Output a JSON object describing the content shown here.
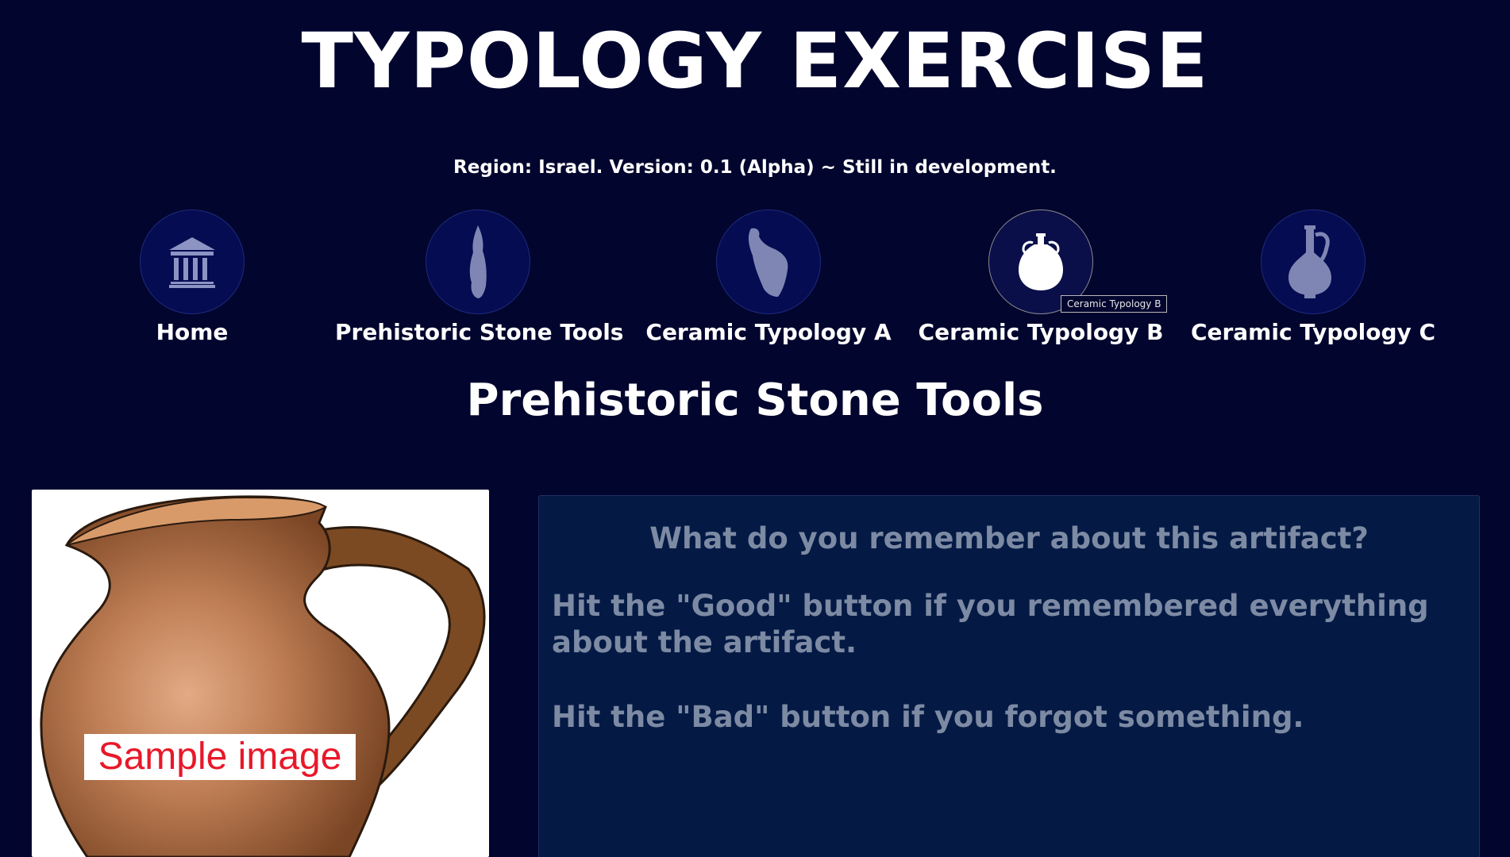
{
  "header": {
    "title": "TYPOLOGY EXERCISE",
    "subtitle": "Region: Israel. Version: 0.1 (Alpha) ~ Still in development."
  },
  "nav": {
    "items": [
      {
        "label": "Home",
        "icon": "building-icon"
      },
      {
        "label": "Prehistoric Stone Tools",
        "icon": "stone-tool-icon"
      },
      {
        "label": "Ceramic Typology A",
        "icon": "pottery-shard-icon"
      },
      {
        "label": "Ceramic Typology B",
        "icon": "amphora-icon",
        "active": true
      },
      {
        "label": "Ceramic Typology C",
        "icon": "jug-icon"
      }
    ],
    "tooltip": "Ceramic Typology B"
  },
  "section": {
    "title": "Prehistoric Stone Tools"
  },
  "artifact": {
    "image_label": "Sample image"
  },
  "prompt": {
    "question": "What do you remember about this artifact?",
    "good_instruction": "Hit the \"Good\" button if you remembered everything about the artifact.",
    "bad_instruction": "Hit the \"Bad\" button if you forgot something."
  },
  "colors": {
    "background": "#02052e",
    "panel": "#041a45",
    "nav_circle": "#050c52",
    "muted_text": "#7d8aa3",
    "sample_label_text": "#e8182a"
  }
}
